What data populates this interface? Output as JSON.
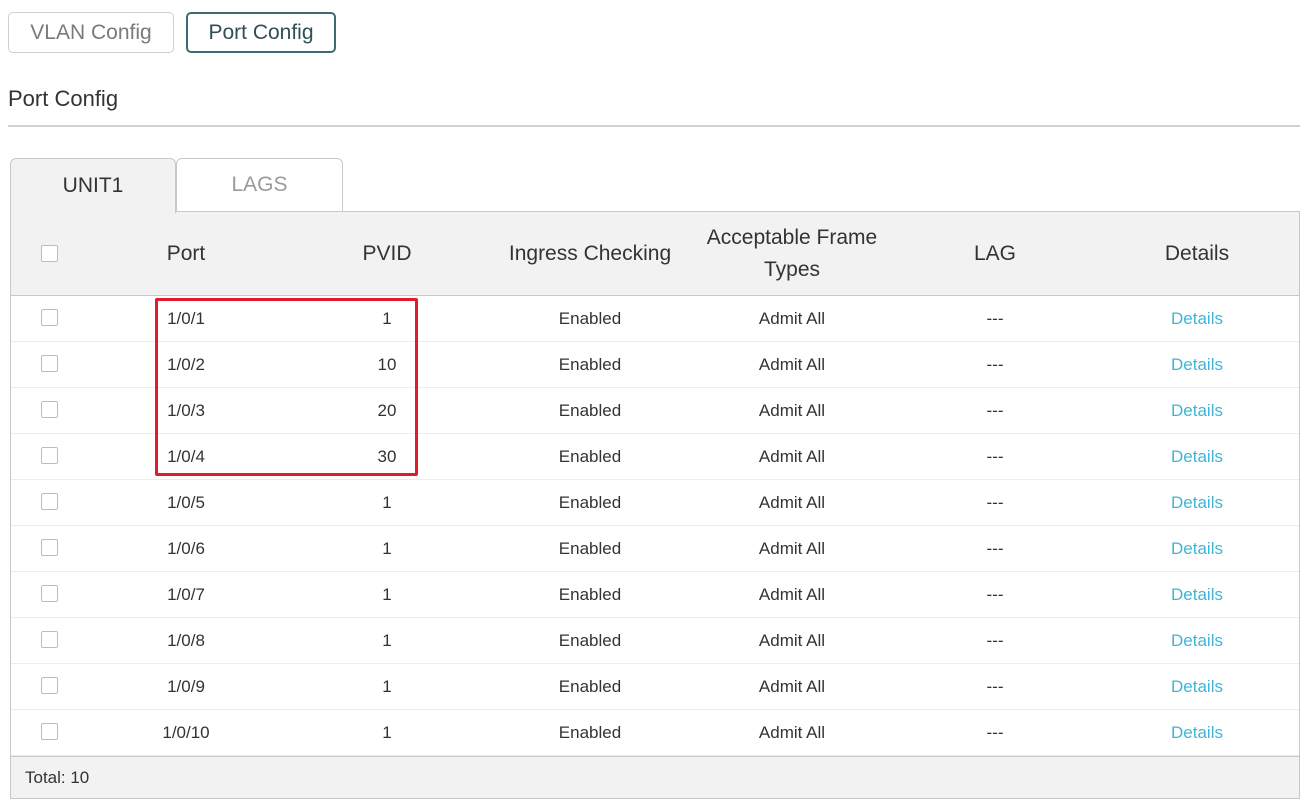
{
  "top_tabs": {
    "vlan_config": "VLAN Config",
    "port_config": "Port Config",
    "active": "port_config"
  },
  "section_title": "Port Config",
  "unit_tabs": {
    "unit1": "UNIT1",
    "lags": "LAGS",
    "active": "unit1"
  },
  "table": {
    "headers": {
      "port": "Port",
      "pvid": "PVID",
      "ingress": "Ingress Checking",
      "frame_types_line1": "Acceptable Frame",
      "frame_types_line2": "Types",
      "lag": "LAG",
      "details": "Details"
    },
    "rows": [
      {
        "port": "1/0/1",
        "pvid": "1",
        "ingress": "Enabled",
        "frame": "Admit All",
        "lag": "---",
        "details": "Details"
      },
      {
        "port": "1/0/2",
        "pvid": "10",
        "ingress": "Enabled",
        "frame": "Admit All",
        "lag": "---",
        "details": "Details"
      },
      {
        "port": "1/0/3",
        "pvid": "20",
        "ingress": "Enabled",
        "frame": "Admit All",
        "lag": "---",
        "details": "Details"
      },
      {
        "port": "1/0/4",
        "pvid": "30",
        "ingress": "Enabled",
        "frame": "Admit All",
        "lag": "---",
        "details": "Details"
      },
      {
        "port": "1/0/5",
        "pvid": "1",
        "ingress": "Enabled",
        "frame": "Admit All",
        "lag": "---",
        "details": "Details"
      },
      {
        "port": "1/0/6",
        "pvid": "1",
        "ingress": "Enabled",
        "frame": "Admit All",
        "lag": "---",
        "details": "Details"
      },
      {
        "port": "1/0/7",
        "pvid": "1",
        "ingress": "Enabled",
        "frame": "Admit All",
        "lag": "---",
        "details": "Details"
      },
      {
        "port": "1/0/8",
        "pvid": "1",
        "ingress": "Enabled",
        "frame": "Admit All",
        "lag": "---",
        "details": "Details"
      },
      {
        "port": "1/0/9",
        "pvid": "1",
        "ingress": "Enabled",
        "frame": "Admit All",
        "lag": "---",
        "details": "Details"
      },
      {
        "port": "1/0/10",
        "pvid": "1",
        "ingress": "Enabled",
        "frame": "Admit All",
        "lag": "---",
        "details": "Details"
      }
    ],
    "footer_total": "Total: 10"
  },
  "colors": {
    "active_tab_border": "#3d6b73",
    "link": "#3fb5d6",
    "highlight": "#e11b2b",
    "header_bg": "#f2f2f2"
  }
}
